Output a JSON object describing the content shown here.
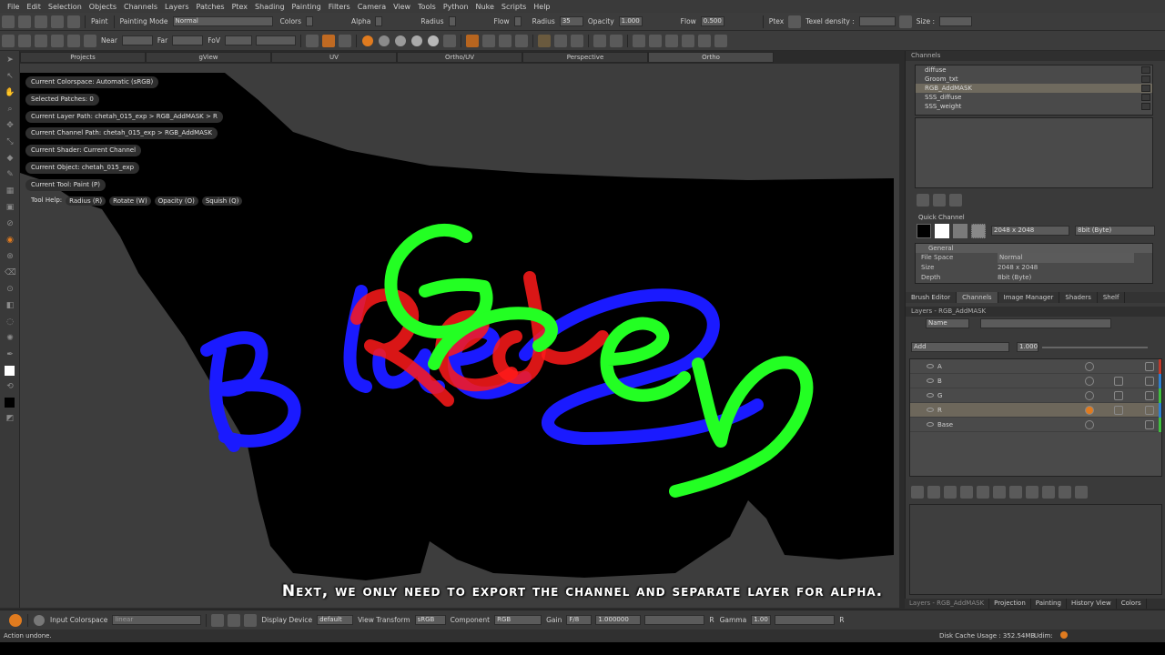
{
  "menu": [
    "File",
    "Edit",
    "Selection",
    "Objects",
    "Channels",
    "Layers",
    "Patches",
    "Ptex",
    "Shading",
    "Painting",
    "Filters",
    "Camera",
    "View",
    "Tools",
    "Python",
    "Nuke",
    "Scripts",
    "Help"
  ],
  "toolbar1": {
    "paint_label": "Paint",
    "painting_mode_label": "Painting Mode",
    "painting_mode_value": "Normal",
    "colors_label": "Colors",
    "alpha_label": "Alpha",
    "radius_check_label": "Radius",
    "flow_check_label": "Flow",
    "radius_label": "Radius",
    "radius_value": "35",
    "opacity_label": "Opacity",
    "opacity_value": "1.000",
    "flow_label": "Flow",
    "flow_value": "0.500",
    "ptex_label": "Ptex",
    "texel_density_label": "Texel density :",
    "size_label": "Size :"
  },
  "toolbar2": {
    "near_label": "Near",
    "far_label": "Far",
    "fov_label": "FoV"
  },
  "viewport_tabs": [
    "Projects",
    "gView",
    "UV",
    "Ortho/UV",
    "Perspective",
    "Ortho"
  ],
  "active_tab": 5,
  "info": [
    "Current Colorspace: Automatic (sRGB)",
    "Selected Patches: 0",
    "Current Layer Path: chetah_015_exp > RGB_AddMASK > R",
    "Current Channel Path: chetah_015_exp > RGB_AddMASK",
    "Current Shader: Current Channel",
    "Current Object: chetah_015_exp",
    "Current Tool: Paint (P)"
  ],
  "tool_help": {
    "label": "Tool Help:",
    "items": [
      "Radius (R)",
      "Rotate (W)",
      "Opacity (O)",
      "Squish (Q)"
    ]
  },
  "subtitle": "Next, we only need to export the channel and separate layer for alpha.",
  "channels": {
    "title": "Channels",
    "items": [
      "diffuse",
      "Groom_txt",
      "RGB_AddMASK",
      "SSS_diffuse",
      "SSS_weight"
    ],
    "selected": 2
  },
  "quick_channel": {
    "title": "Quick Channel",
    "size_value": "2048 x 2048",
    "depth_value": "8bit (Byte)",
    "general_label": "General",
    "props": [
      {
        "key": "File Space",
        "value": "Normal"
      },
      {
        "key": "Size",
        "value": "2048 x 2048"
      },
      {
        "key": "Depth",
        "value": "8bit (Byte)"
      }
    ]
  },
  "right_tabs": [
    "Brush Editor",
    "Channels",
    "Image Manager",
    "Shaders",
    "Shelf"
  ],
  "right_active_tab": 1,
  "layers": {
    "title": "Layers - RGB_AddMASK",
    "filter_label": "Name",
    "blend_mode": "Add",
    "opacity": "1.000",
    "rows": [
      {
        "name": "A",
        "bar": "#c0392b"
      },
      {
        "name": "B",
        "bar": "#2d7fd0"
      },
      {
        "name": "G",
        "bar": "#3fbf3f"
      },
      {
        "name": "R",
        "bar": "#2d7fd0"
      },
      {
        "name": "Base",
        "bar": "#3fbf3f"
      }
    ],
    "selected": 3
  },
  "bottom_tabs": [
    "Layers - RGB_AddMASK",
    "Projection",
    "Painting",
    "History View",
    "Colors"
  ],
  "bottom_bar": {
    "input_colorspace_label": "Input Colorspace",
    "input_colorspace_value": "linear",
    "display_device_label": "Display Device",
    "display_device_value": "default",
    "view_transform_label": "View Transform",
    "view_transform_value": "sRGB",
    "component_label": "Component",
    "component_value": "RGB",
    "gain_label": "Gain",
    "gain_value": "F/8",
    "gain_number": "1.000000",
    "r_label": "R",
    "gamma_label": "Gamma",
    "gamma_value": "1.00",
    "r2_label": "R"
  },
  "status": {
    "message": "Action undone.",
    "disk_cache": "Disk Cache Usage : 352.54MB",
    "udim": "Udim:"
  },
  "colors": {
    "green": "#23ff23",
    "blue": "#1a1aff",
    "red": "#ff1a1a",
    "viewport_bg": "#3d3d3d",
    "mesh": "#000000",
    "accent": "#e07b1f"
  }
}
